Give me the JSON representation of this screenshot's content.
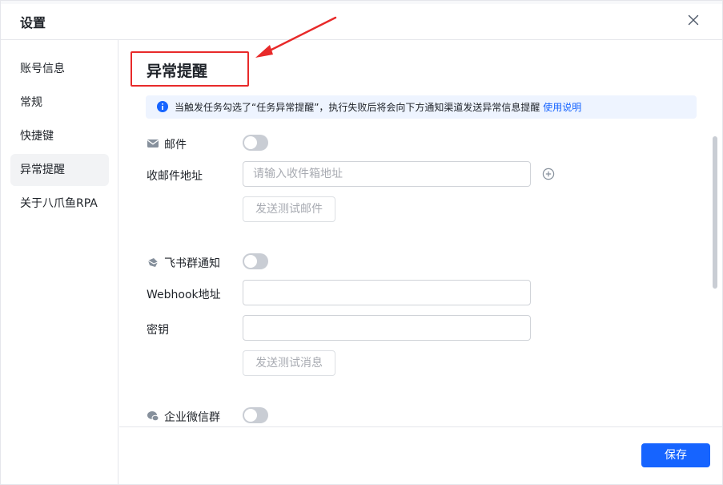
{
  "dialog": {
    "title": "设置",
    "close_icon": "close-icon"
  },
  "sidebar": {
    "items": [
      {
        "label": "账号信息",
        "active": false
      },
      {
        "label": "常规",
        "active": false
      },
      {
        "label": "快捷键",
        "active": false
      },
      {
        "label": "异常提醒",
        "active": true
      },
      {
        "label": "关于八爪鱼RPA",
        "active": false
      }
    ]
  },
  "main": {
    "section_title": "异常提醒",
    "info": {
      "icon": "info-icon",
      "text": "当触发任务勾选了“任务异常提醒”，执行失败后将会向下方通知渠道发送异常信息提醒",
      "link": "使用说明"
    },
    "email": {
      "icon": "mail-icon",
      "label": "邮件",
      "enabled": false,
      "recipient_label": "收邮件地址",
      "recipient_placeholder": "请输入收件箱地址",
      "recipient_value": "",
      "add_icon": "add-circle-icon",
      "test_button": "发送测试邮件"
    },
    "feishu": {
      "icon": "feishu-icon",
      "label": "飞书群通知",
      "enabled": false,
      "webhook_label": "Webhook地址",
      "webhook_value": "",
      "secret_label": "密钥",
      "secret_value": "",
      "test_button": "发送测试消息"
    },
    "wecom": {
      "icon": "wecom-icon",
      "label": "企业微信群",
      "enabled": false
    }
  },
  "footer": {
    "save_label": "保存"
  },
  "colors": {
    "accent": "#1664ff",
    "annotation": "#e82a2a",
    "info_bg": "#eef4ff",
    "toggle_off": "#c9cdd4"
  }
}
